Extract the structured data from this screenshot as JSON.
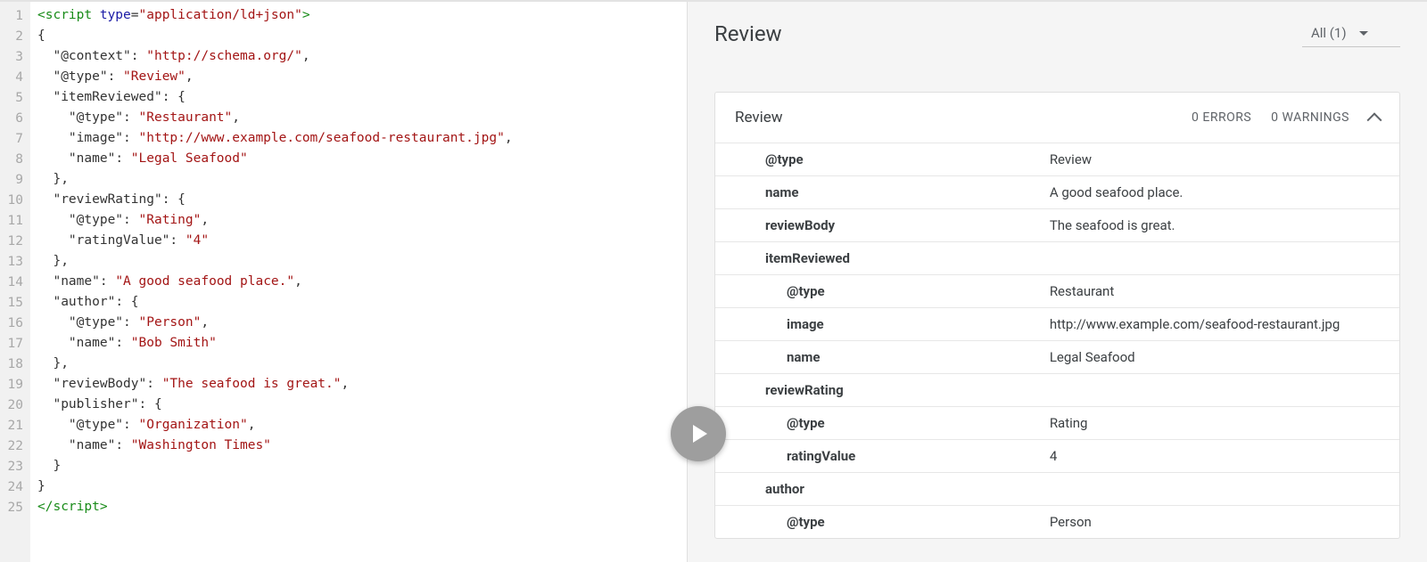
{
  "editor": {
    "line_count": 25,
    "code_tokens": [
      [
        [
          "tok-tag",
          "<script"
        ],
        [
          "tok-punc",
          " "
        ],
        [
          "tok-attr",
          "type"
        ],
        [
          "tok-punc",
          "="
        ],
        [
          "tok-str",
          "\"application/ld+json\""
        ],
        [
          "tok-tag",
          ">"
        ]
      ],
      [
        [
          "tok-punc",
          "{"
        ]
      ],
      [
        [
          "tok-punc",
          "  "
        ],
        [
          "tok-key",
          "\"@context\""
        ],
        [
          "tok-punc",
          ": "
        ],
        [
          "tok-str",
          "\"http://schema.org/\""
        ],
        [
          "tok-punc",
          ","
        ]
      ],
      [
        [
          "tok-punc",
          "  "
        ],
        [
          "tok-key",
          "\"@type\""
        ],
        [
          "tok-punc",
          ": "
        ],
        [
          "tok-str",
          "\"Review\""
        ],
        [
          "tok-punc",
          ","
        ]
      ],
      [
        [
          "tok-punc",
          "  "
        ],
        [
          "tok-key",
          "\"itemReviewed\""
        ],
        [
          "tok-punc",
          ": {"
        ]
      ],
      [
        [
          "tok-punc",
          "    "
        ],
        [
          "tok-key",
          "\"@type\""
        ],
        [
          "tok-punc",
          ": "
        ],
        [
          "tok-str",
          "\"Restaurant\""
        ],
        [
          "tok-punc",
          ","
        ]
      ],
      [
        [
          "tok-punc",
          "    "
        ],
        [
          "tok-key",
          "\"image\""
        ],
        [
          "tok-punc",
          ": "
        ],
        [
          "tok-str",
          "\"http://www.example.com/seafood-restaurant.jpg\""
        ],
        [
          "tok-punc",
          ","
        ]
      ],
      [
        [
          "tok-punc",
          "    "
        ],
        [
          "tok-key",
          "\"name\""
        ],
        [
          "tok-punc",
          ": "
        ],
        [
          "tok-str",
          "\"Legal Seafood\""
        ]
      ],
      [
        [
          "tok-punc",
          "  },"
        ]
      ],
      [
        [
          "tok-punc",
          "  "
        ],
        [
          "tok-key",
          "\"reviewRating\""
        ],
        [
          "tok-punc",
          ": {"
        ]
      ],
      [
        [
          "tok-punc",
          "    "
        ],
        [
          "tok-key",
          "\"@type\""
        ],
        [
          "tok-punc",
          ": "
        ],
        [
          "tok-str",
          "\"Rating\""
        ],
        [
          "tok-punc",
          ","
        ]
      ],
      [
        [
          "tok-punc",
          "    "
        ],
        [
          "tok-key",
          "\"ratingValue\""
        ],
        [
          "tok-punc",
          ": "
        ],
        [
          "tok-str",
          "\"4\""
        ]
      ],
      [
        [
          "tok-punc",
          "  },"
        ]
      ],
      [
        [
          "tok-punc",
          "  "
        ],
        [
          "tok-key",
          "\"name\""
        ],
        [
          "tok-punc",
          ": "
        ],
        [
          "tok-str",
          "\"A good seafood place.\""
        ],
        [
          "tok-punc",
          ","
        ]
      ],
      [
        [
          "tok-punc",
          "  "
        ],
        [
          "tok-key",
          "\"author\""
        ],
        [
          "tok-punc",
          ": {"
        ]
      ],
      [
        [
          "tok-punc",
          "    "
        ],
        [
          "tok-key",
          "\"@type\""
        ],
        [
          "tok-punc",
          ": "
        ],
        [
          "tok-str",
          "\"Person\""
        ],
        [
          "tok-punc",
          ","
        ]
      ],
      [
        [
          "tok-punc",
          "    "
        ],
        [
          "tok-key",
          "\"name\""
        ],
        [
          "tok-punc",
          ": "
        ],
        [
          "tok-str",
          "\"Bob Smith\""
        ]
      ],
      [
        [
          "tok-punc",
          "  },"
        ]
      ],
      [
        [
          "tok-punc",
          "  "
        ],
        [
          "tok-key",
          "\"reviewBody\""
        ],
        [
          "tok-punc",
          ": "
        ],
        [
          "tok-str",
          "\"The seafood is great.\""
        ],
        [
          "tok-punc",
          ","
        ]
      ],
      [
        [
          "tok-punc",
          "  "
        ],
        [
          "tok-key",
          "\"publisher\""
        ],
        [
          "tok-punc",
          ": {"
        ]
      ],
      [
        [
          "tok-punc",
          "    "
        ],
        [
          "tok-key",
          "\"@type\""
        ],
        [
          "tok-punc",
          ": "
        ],
        [
          "tok-str",
          "\"Organization\""
        ],
        [
          "tok-punc",
          ","
        ]
      ],
      [
        [
          "tok-punc",
          "    "
        ],
        [
          "tok-key",
          "\"name\""
        ],
        [
          "tok-punc",
          ": "
        ],
        [
          "tok-str",
          "\"Washington Times\""
        ]
      ],
      [
        [
          "tok-punc",
          "  }"
        ]
      ],
      [
        [
          "tok-punc",
          "}"
        ]
      ],
      [
        [
          "tok-tag",
          "</"
        ],
        [
          "tok-tag",
          "script"
        ],
        [
          "tok-tag",
          ">"
        ]
      ]
    ]
  },
  "results": {
    "title": "Review",
    "filter_label": "All (1)",
    "card": {
      "title": "Review",
      "errors_label": "0 ERRORS",
      "warnings_label": "0 WARNINGS",
      "rows": [
        {
          "key": "@type",
          "val": "Review",
          "indent": 1
        },
        {
          "key": "name",
          "val": "A good seafood place.",
          "indent": 1
        },
        {
          "key": "reviewBody",
          "val": "The seafood is great.",
          "indent": 1
        },
        {
          "key": "itemReviewed",
          "val": "",
          "indent": 1,
          "section": true
        },
        {
          "key": "@type",
          "val": "Restaurant",
          "indent": 2
        },
        {
          "key": "image",
          "val": "http://www.example.com/seafood-restaurant.jpg",
          "indent": 2
        },
        {
          "key": "name",
          "val": "Legal Seafood",
          "indent": 2
        },
        {
          "key": "reviewRating",
          "val": "",
          "indent": 1,
          "section": true
        },
        {
          "key": "@type",
          "val": "Rating",
          "indent": 2
        },
        {
          "key": "ratingValue",
          "val": "4",
          "indent": 2
        },
        {
          "key": "author",
          "val": "",
          "indent": 1,
          "section": true
        },
        {
          "key": "@type",
          "val": "Person",
          "indent": 2
        }
      ]
    }
  }
}
